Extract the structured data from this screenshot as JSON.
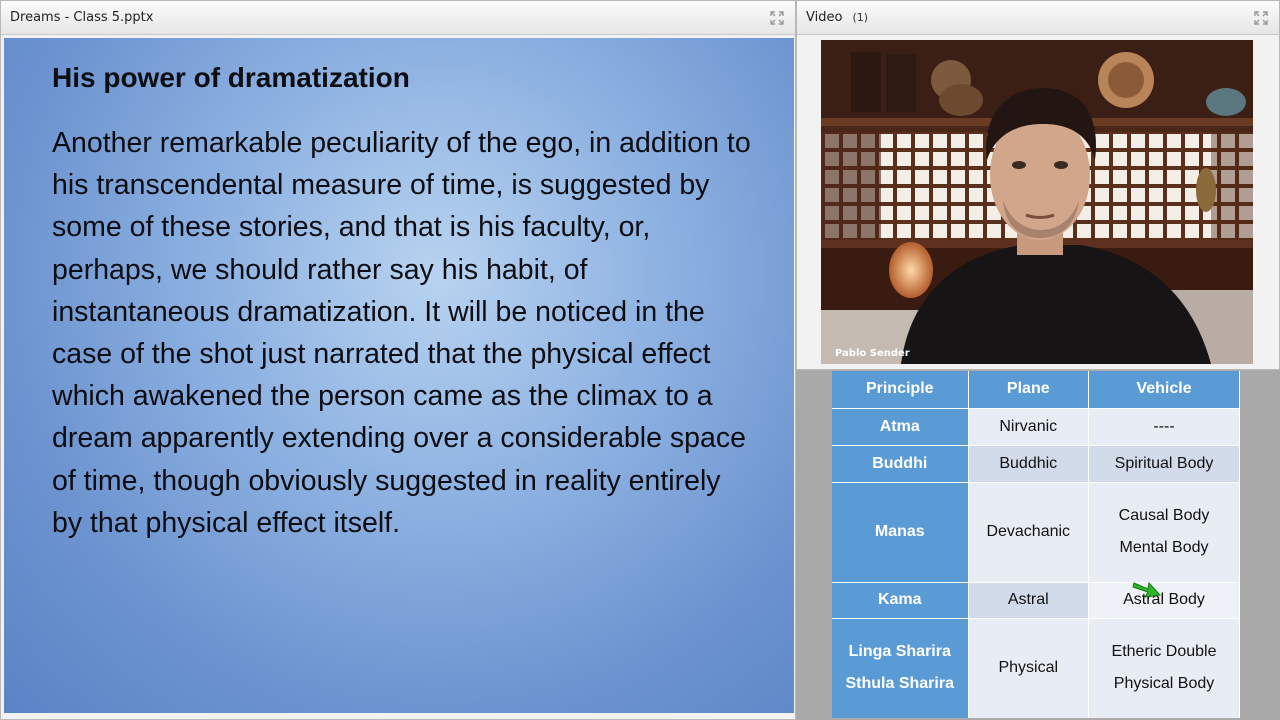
{
  "slide_pod": {
    "title": "Dreams - Class 5.pptx"
  },
  "slide": {
    "title": "His power of dramatization",
    "body": "Another remarkable peculiarity of the ego, in addition to his transcendental measure of time, is suggested by some of these stories, and that is his faculty, or, perhaps, we should rather say his habit, of instantaneous dramatization. It will be noticed in the case of the shot just narrated that the physical effect which awakened the person came as the climax to a dream apparently extending over a considerable space of time, though obviously suggested in reality entirely by that physical effect itself."
  },
  "video_pod": {
    "title": "Video",
    "count": "(1)",
    "speaker": "Pablo Sender"
  },
  "table": {
    "headers": [
      "Principle",
      "Plane",
      "Vehicle"
    ],
    "rows": [
      {
        "principle": [
          "Atma"
        ],
        "plane": "Nirvanic",
        "vehicle": [
          "----"
        ]
      },
      {
        "principle": [
          "Buddhi"
        ],
        "plane": "Buddhic",
        "vehicle": [
          "Spiritual Body"
        ]
      },
      {
        "principle": [
          "Manas"
        ],
        "plane": "Devachanic",
        "vehicle": [
          "Causal Body",
          "Mental Body"
        ]
      },
      {
        "principle": [
          "Kama"
        ],
        "plane": "Astral",
        "vehicle": [
          "Astral Body"
        ]
      },
      {
        "principle": [
          "Linga Sharira",
          "Sthula Sharira"
        ],
        "plane": "Physical",
        "vehicle": [
          "Etheric Double",
          "Physical Body"
        ]
      }
    ]
  },
  "icons": {
    "fullscreen": "fullscreen-icon",
    "pointer": "green-arrow-icon"
  },
  "colors": {
    "slide_bg": "#8fb3e2",
    "table_header": "#5b9bd5",
    "arrow": "#2fb52a"
  }
}
